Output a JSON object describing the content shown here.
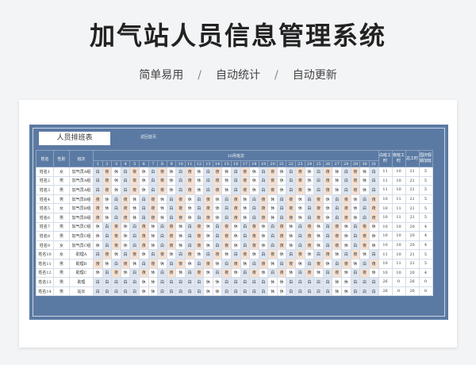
{
  "heading": "加气站人员信息管理系统",
  "features": [
    "简单易用",
    "自动统计",
    "自动更新"
  ],
  "separator": "/",
  "sheet": {
    "title": "人员排班表",
    "note": "返回首页",
    "headers": {
      "name": "姓名",
      "gender": "性别",
      "shift": "班次",
      "month": "10月班次",
      "days": [
        "1",
        "2",
        "3",
        "4",
        "5",
        "6",
        "7",
        "8",
        "9",
        "10",
        "11",
        "12",
        "13",
        "14",
        "15",
        "16",
        "17",
        "18",
        "19",
        "20",
        "21",
        "22",
        "23",
        "24",
        "25",
        "26",
        "27",
        "28",
        "29",
        "30",
        "31"
      ],
      "day_hours": "白班工时",
      "night_hours": "夜班工时",
      "total": "总工时",
      "extra": "国庆假期加班"
    },
    "rows": [
      {
        "name": "姓名1",
        "gender": "女",
        "shift": "加气员A组",
        "days": [
          "白",
          "夜",
          "休",
          "白",
          "夜",
          "休",
          "白",
          "夜",
          "休",
          "白",
          "夜",
          "休",
          "白",
          "夜",
          "休",
          "白",
          "夜",
          "休",
          "白",
          "夜",
          "休",
          "白",
          "夜",
          "休",
          "白",
          "夜",
          "休",
          "白",
          "夜",
          "休",
          "白"
        ],
        "day_hours": "11",
        "night_hours": "10",
        "total": "21",
        "extra": "5"
      },
      {
        "name": "姓名2",
        "gender": "男",
        "shift": "加气员A组",
        "days": [
          "白",
          "夜",
          "休",
          "白",
          "夜",
          "休",
          "白",
          "夜",
          "休",
          "白",
          "夜",
          "休",
          "白",
          "夜",
          "休",
          "白",
          "夜",
          "休",
          "白",
          "夜",
          "休",
          "白",
          "夜",
          "休",
          "白",
          "夜",
          "休",
          "白",
          "夜",
          "休",
          "白"
        ],
        "day_hours": "11",
        "night_hours": "10",
        "total": "21",
        "extra": "5"
      },
      {
        "name": "姓名3",
        "gender": "男",
        "shift": "加气员A组",
        "days": [
          "白",
          "夜",
          "休",
          "白",
          "夜",
          "休",
          "白",
          "夜",
          "休",
          "白",
          "夜",
          "休",
          "白",
          "夜",
          "休",
          "白",
          "夜",
          "休",
          "白",
          "夜",
          "休",
          "白",
          "夜",
          "休",
          "白",
          "夜",
          "休",
          "白",
          "夜",
          "休",
          "白"
        ],
        "day_hours": "11",
        "night_hours": "10",
        "total": "21",
        "extra": "5"
      },
      {
        "name": "姓名4",
        "gender": "男",
        "shift": "加气员B组",
        "days": [
          "夜",
          "休",
          "白",
          "夜",
          "休",
          "白",
          "夜",
          "休",
          "白",
          "夜",
          "休",
          "白",
          "夜",
          "休",
          "白",
          "夜",
          "休",
          "白",
          "夜",
          "休",
          "白",
          "夜",
          "休",
          "白",
          "夜",
          "休",
          "白",
          "夜",
          "休",
          "白",
          "夜"
        ],
        "day_hours": "10",
        "night_hours": "11",
        "total": "21",
        "extra": "5"
      },
      {
        "name": "姓名5",
        "gender": "女",
        "shift": "加气员B组",
        "days": [
          "夜",
          "休",
          "白",
          "夜",
          "休",
          "白",
          "夜",
          "休",
          "白",
          "夜",
          "休",
          "白",
          "夜",
          "休",
          "白",
          "夜",
          "休",
          "白",
          "夜",
          "休",
          "白",
          "夜",
          "休",
          "白",
          "夜",
          "休",
          "白",
          "夜",
          "休",
          "白",
          "夜"
        ],
        "day_hours": "10",
        "night_hours": "11",
        "total": "21",
        "extra": "5"
      },
      {
        "name": "姓名6",
        "gender": "男",
        "shift": "加气员B组",
        "days": [
          "夜",
          "休",
          "白",
          "夜",
          "休",
          "白",
          "夜",
          "休",
          "白",
          "夜",
          "休",
          "白",
          "夜",
          "休",
          "白",
          "夜",
          "休",
          "白",
          "夜",
          "休",
          "白",
          "夜",
          "休",
          "白",
          "夜",
          "休",
          "白",
          "夜",
          "休",
          "白",
          "夜"
        ],
        "day_hours": "10",
        "night_hours": "11",
        "total": "21",
        "extra": "5"
      },
      {
        "name": "姓名7",
        "gender": "男",
        "shift": "加气员C组",
        "days": [
          "休",
          "白",
          "夜",
          "休",
          "白",
          "夜",
          "休",
          "白",
          "夜",
          "休",
          "白",
          "夜",
          "休",
          "白",
          "夜",
          "休",
          "白",
          "夜",
          "休",
          "白",
          "夜",
          "休",
          "白",
          "夜",
          "休",
          "白",
          "夜",
          "休",
          "白",
          "夜",
          "休"
        ],
        "day_hours": "10",
        "night_hours": "10",
        "total": "20",
        "extra": "4"
      },
      {
        "name": "姓名8",
        "gender": "男",
        "shift": "加气员C组",
        "days": [
          "休",
          "白",
          "夜",
          "休",
          "白",
          "夜",
          "休",
          "白",
          "夜",
          "休",
          "白",
          "夜",
          "休",
          "白",
          "夜",
          "休",
          "白",
          "夜",
          "休",
          "白",
          "夜",
          "休",
          "白",
          "夜",
          "休",
          "白",
          "夜",
          "休",
          "白",
          "夜",
          "休"
        ],
        "day_hours": "10",
        "night_hours": "10",
        "total": "20",
        "extra": "4"
      },
      {
        "name": "姓名9",
        "gender": "女",
        "shift": "加气员C组",
        "days": [
          "休",
          "白",
          "夜",
          "休",
          "白",
          "夜",
          "休",
          "白",
          "夜",
          "休",
          "白",
          "夜",
          "休",
          "白",
          "夜",
          "休",
          "白",
          "夜",
          "休",
          "白",
          "夜",
          "休",
          "白",
          "夜",
          "休",
          "白",
          "夜",
          "休",
          "白",
          "夜",
          "休"
        ],
        "day_hours": "10",
        "night_hours": "10",
        "total": "20",
        "extra": "4"
      },
      {
        "name": "姓名10",
        "gender": "女",
        "shift": "助理A",
        "days": [
          "白",
          "夜",
          "休",
          "白",
          "夜",
          "休",
          "白",
          "夜",
          "休",
          "白",
          "夜",
          "休",
          "白",
          "夜",
          "休",
          "白",
          "夜",
          "休",
          "白",
          "夜",
          "休",
          "白",
          "夜",
          "休",
          "白",
          "夜",
          "休",
          "白",
          "夜",
          "休",
          "白"
        ],
        "day_hours": "11",
        "night_hours": "10",
        "total": "21",
        "extra": "5"
      },
      {
        "name": "姓名11",
        "gender": "男",
        "shift": "助理B",
        "days": [
          "夜",
          "休",
          "白",
          "夜",
          "休",
          "白",
          "夜",
          "休",
          "白",
          "夜",
          "休",
          "白",
          "夜",
          "休",
          "白",
          "夜",
          "休",
          "白",
          "夜",
          "休",
          "白",
          "夜",
          "休",
          "白",
          "夜",
          "休",
          "白",
          "夜",
          "休",
          "白",
          "夜"
        ],
        "day_hours": "10",
        "night_hours": "11",
        "total": "21",
        "extra": "5"
      },
      {
        "name": "姓名12",
        "gender": "男",
        "shift": "助理C",
        "days": [
          "休",
          "白",
          "夜",
          "休",
          "白",
          "夜",
          "休",
          "白",
          "夜",
          "休",
          "白",
          "夜",
          "休",
          "白",
          "夜",
          "休",
          "白",
          "夜",
          "休",
          "白",
          "夜",
          "休",
          "白",
          "夜",
          "休",
          "白",
          "夜",
          "休",
          "白",
          "夜",
          "休"
        ],
        "day_hours": "10",
        "night_hours": "10",
        "total": "20",
        "extra": "4"
      },
      {
        "name": "姓名13",
        "gender": "男",
        "shift": "助理",
        "days": [
          "白",
          "白",
          "白",
          "白",
          "白",
          "休",
          "休",
          "白",
          "白",
          "白",
          "白",
          "白",
          "休",
          "休",
          "白",
          "白",
          "白",
          "白",
          "白",
          "休",
          "休",
          "白",
          "白",
          "白",
          "白",
          "白",
          "休",
          "休",
          "白",
          "白",
          "白"
        ],
        "day_hours": "26",
        "night_hours": "0",
        "total": "26",
        "extra": "0"
      },
      {
        "name": "姓名14",
        "gender": "男",
        "shift": "站长",
        "days": [
          "白",
          "白",
          "白",
          "白",
          "白",
          "休",
          "休",
          "白",
          "白",
          "白",
          "白",
          "白",
          "休",
          "休",
          "白",
          "白",
          "白",
          "白",
          "白",
          "休",
          "休",
          "白",
          "白",
          "白",
          "白",
          "白",
          "休",
          "休",
          "白",
          "白",
          "白"
        ],
        "day_hours": "26",
        "night_hours": "0",
        "total": "26",
        "extra": "0"
      }
    ]
  }
}
